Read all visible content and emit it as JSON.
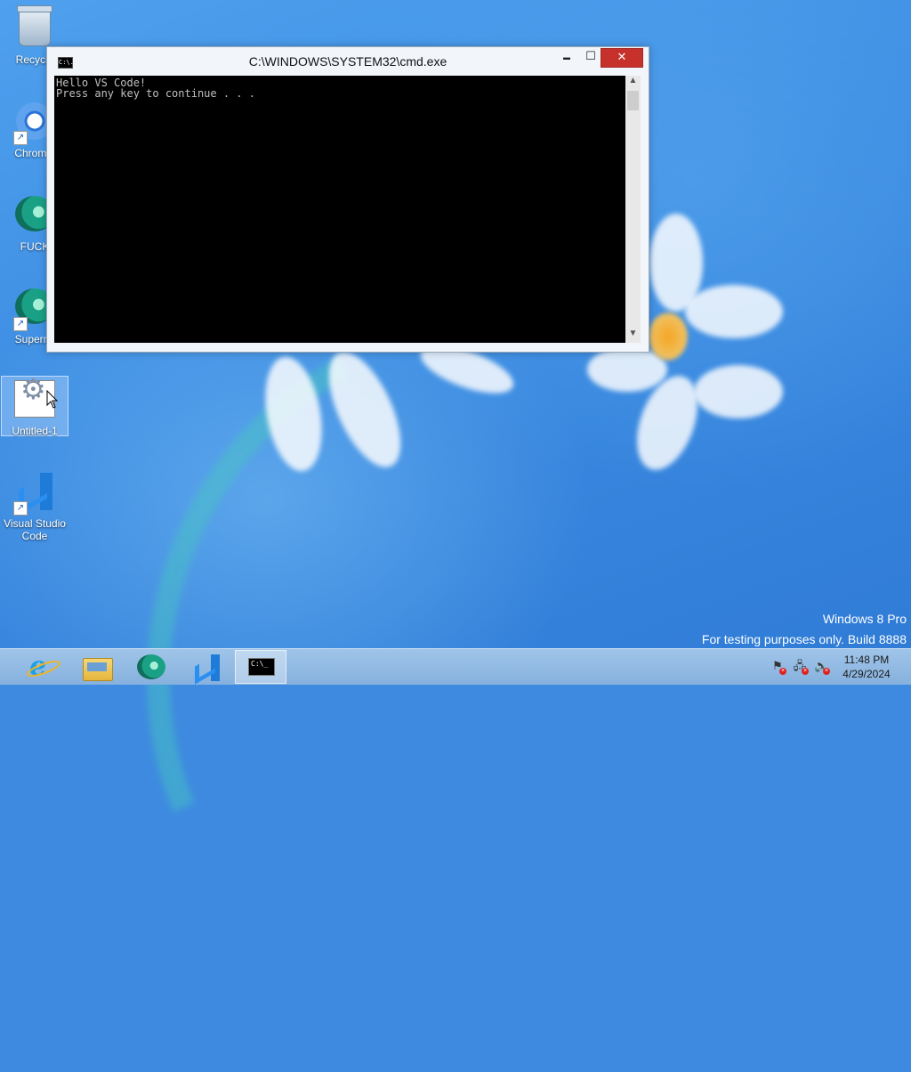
{
  "desktop": {
    "icons": [
      {
        "label": "Recycle",
        "name": "recycle-bin"
      },
      {
        "label": "Chromiu",
        "name": "chromium"
      },
      {
        "label": "FUCK",
        "name": "fuck-app"
      },
      {
        "label": "Supermi",
        "name": "supermium"
      },
      {
        "label": "Untitled-1",
        "name": "untitled-1"
      },
      {
        "label_line1": "Visual Studio",
        "label_line2": "Code",
        "name": "visual-studio-code"
      }
    ]
  },
  "cmd_window": {
    "title": "C:\\WINDOWS\\SYSTEM32\\cmd.exe",
    "app_icon_text": "C:\\.",
    "minimize_glyph": "▬",
    "maximize_glyph": "☐",
    "close_glyph": "✕",
    "console_lines": [
      "Hello VS Code!",
      "Press any key to continue . . ."
    ]
  },
  "watermark": {
    "line1": "Windows 8 Pro",
    "line2": "For testing purposes only. Build 8888"
  },
  "taskbar": {
    "buttons": [
      {
        "name": "internet-explorer",
        "glyph": "e"
      },
      {
        "name": "file-explorer"
      },
      {
        "name": "wolf-browser"
      },
      {
        "name": "visual-studio-code"
      },
      {
        "name": "command-prompt",
        "glyph": "C:\\_",
        "active": true
      }
    ],
    "clock": {
      "time": "11:48 PM",
      "date": "4/29/2024"
    }
  }
}
